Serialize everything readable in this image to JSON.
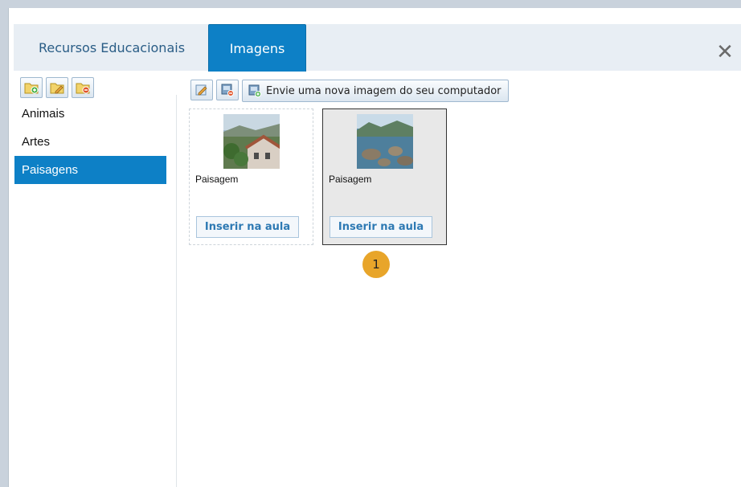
{
  "tabs": [
    {
      "label": "Recursos Educacionais"
    },
    {
      "label": "Imagens"
    }
  ],
  "close_icon": "close-icon",
  "sidebar": {
    "toolbar_icons": [
      "folder-add-icon",
      "folder-edit-icon",
      "folder-delete-icon"
    ],
    "categories": [
      {
        "label": "Animais"
      },
      {
        "label": "Artes"
      },
      {
        "label": "Paisagens",
        "selected": true
      }
    ]
  },
  "main": {
    "toolbar_icons": [
      "edit-image-icon",
      "delete-image-icon",
      "upload-image-icon"
    ],
    "upload_label": "Envie uma nova imagem do seu computador",
    "images": [
      {
        "caption": "Paisagem",
        "insert_label": "Inserir na aula"
      },
      {
        "caption": "Paisagem",
        "insert_label": "Inserir na aula",
        "selected": true
      }
    ]
  },
  "step_badge": "1",
  "colors": {
    "accent": "#0d80c6",
    "badge": "#e8a52a"
  }
}
